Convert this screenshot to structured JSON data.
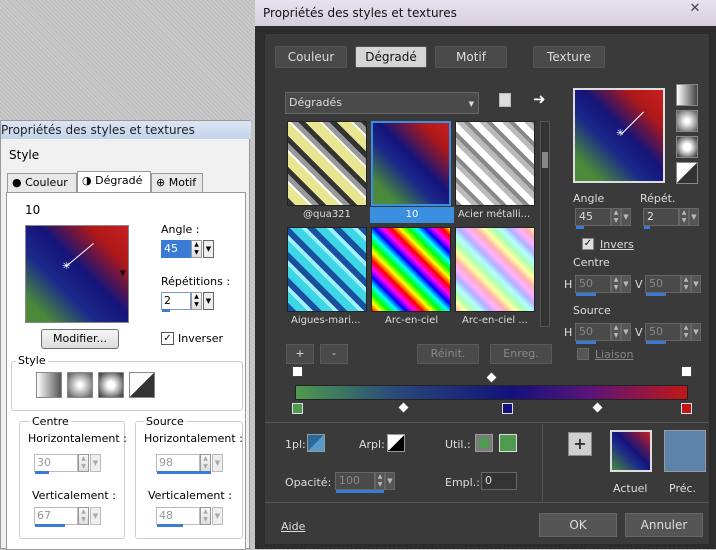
{
  "old_dialog": {
    "title": "Propriétés des styles et textures",
    "style_section": "Style",
    "tabs": [
      {
        "label": "Couleur",
        "active": false
      },
      {
        "label": "Dégradé",
        "active": true
      },
      {
        "label": "Motif",
        "active": false
      }
    ],
    "gradient_name": "10",
    "angle_label": "Angle :",
    "angle_value": "45",
    "repetitions_label": "Répétitions :",
    "repetitions_value": "2",
    "modify_button": "Modifier...",
    "invert_label": "Inverser",
    "invert_checked": true,
    "style_group": "Style",
    "centre_group": "Centre",
    "source_group": "Source",
    "horiz_label": "Horizontalement :",
    "vert_label": "Verticalement :",
    "centre_h": "30",
    "centre_v": "67",
    "source_h": "98",
    "source_v": "48"
  },
  "new_dialog": {
    "title": "Propriétés des styles et textures",
    "close_glyph": "✕",
    "tabs": [
      {
        "label": "Couleur",
        "active": false
      },
      {
        "label": "Dégradé",
        "active": true
      },
      {
        "label": "Motif",
        "active": false
      },
      {
        "label": "Texture",
        "active": false
      }
    ],
    "category_dropdown": "Dégradés",
    "gradients": [
      {
        "label": "@qua321",
        "selected": false
      },
      {
        "label": "10",
        "selected": true
      },
      {
        "label": "Acier métalli...",
        "selected": false
      },
      {
        "label": "Aigues-mari...",
        "selected": false
      },
      {
        "label": "Arc-en-ciel",
        "selected": false
      },
      {
        "label": "Arc-en-ciel ...",
        "selected": false
      }
    ],
    "add_button": "+",
    "remove_button": "-",
    "reset_button": "Réinit.",
    "save_button": "Enreg.",
    "angle_label": "Angle",
    "angle_value": "45",
    "repeat_label": "Répét.",
    "repeat_value": "2",
    "invert_label": "Invers",
    "invert_checked": true,
    "centre_label": "Centre",
    "h_label": "H",
    "v_label": "V",
    "centre_h": "50",
    "centre_v": "50",
    "source_label": "Source",
    "source_h": "50",
    "source_v": "50",
    "link_label": "Liaison",
    "fpl_label": "1pl:",
    "arpl_label": "Arpl:",
    "util_label": "Util.:",
    "opacity_label": "Opacité:",
    "opacity_value": "100",
    "empl_label": "Empl.:",
    "empl_value": "0",
    "plus_button": "+",
    "actual_label": "Actuel",
    "previous_label": "Préc.",
    "help_link": "Aide",
    "ok_button": "OK",
    "cancel_button": "Annuler"
  },
  "colors": {
    "accent_blue": "#3a7bd5",
    "gradient_green": "#4f9a4f",
    "gradient_navy": "#12127a",
    "gradient_red": "#c01818",
    "prec_swatch": "#5c84aa"
  }
}
